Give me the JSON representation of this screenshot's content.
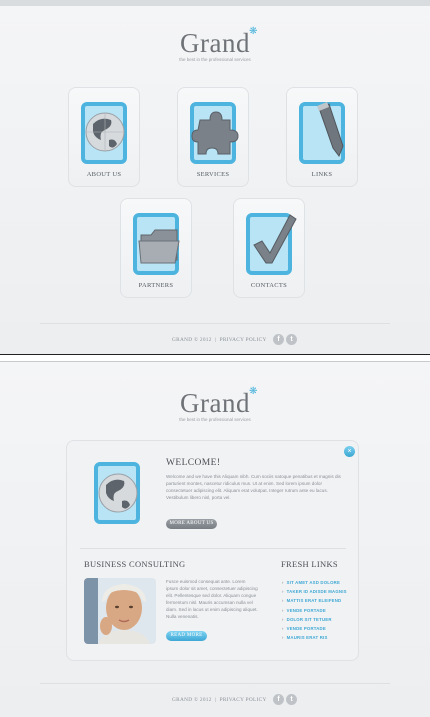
{
  "brand": {
    "logo": "Grand",
    "tagline": "the best in the professional services"
  },
  "tiles": [
    {
      "label": "ABOUT US",
      "icon": "globe-icon"
    },
    {
      "label": "SERVICES",
      "icon": "puzzle-icon"
    },
    {
      "label": "LINKS",
      "icon": "pen-icon"
    },
    {
      "label": "PARTNERS",
      "icon": "folder-icon"
    },
    {
      "label": "CONTACTS",
      "icon": "checkmark-icon"
    }
  ],
  "footer": {
    "copyright": "GRAND © 2012",
    "separator": "|",
    "privacy": "PRIVACY POLICY",
    "facebook": "f",
    "twitter": "t"
  },
  "welcome": {
    "title": "WELCOME!",
    "body": "Welcome and we have this Aliquam nibh. Cum sociis natoque penatibus et magnis dis parturient montes, nascetur ridiculus mus. Ut at enim. Sed lorem ipsum dolor consectetuer adipiscing elit. Aliquam erat volutpat. Integer rutrum ante eu lacus. Vestibulum libero nisl, porta vel.",
    "button": "MORE ABOUT US"
  },
  "close_label": "×",
  "business": {
    "title": "BUSINESS CONSULTING",
    "body": "Fusce euismod consequat ante. Lorem ipsum dolor sit amet, consectetuer adipiscing elit. Pellentesque sed dolor. Aliquam congue fermentum nisl. Mauris accumsan nulla vel diam. Sed in lacus ut enim adipiscing aliquet. Nulla venenatis.",
    "button": "READ MORE"
  },
  "fresh_links": {
    "title": "FRESH LINKS",
    "items": [
      "SIT AMET ASD DOLORE",
      "TAKER ID ADISDE MAGNIS",
      "MATTIS ERAT ELEIFEND",
      "VENDE PORTADE",
      "DOLOR SIT TETUER",
      "VENDE PORTADE",
      "MAURIS ERAT RIS"
    ]
  },
  "colors": {
    "accent": "#3ea8d5",
    "text": "#4a4e53",
    "muted": "#8a8f95"
  }
}
